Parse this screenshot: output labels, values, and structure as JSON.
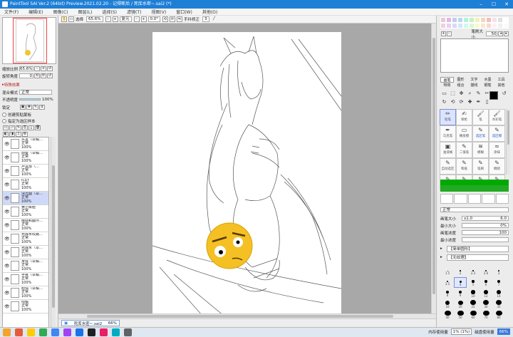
{
  "window": {
    "title": "PaintTool SAI Ver.2 (64bit) Preview.2021.02.20 - 记得断后 / 死库水密~.sai2 (*)"
  },
  "menu": [
    "文件(F)",
    "编辑(E)",
    "图像(C)",
    "图层(L)",
    "选择(S)",
    "滤镜(T)",
    "视图(V)",
    "窗口(W)",
    "其他(O)"
  ],
  "navigator": {
    "zoom_label": "缩放比例",
    "zoom_value": "65.6%",
    "angle_label": "旋转角度",
    "angle_value": "0"
  },
  "layer_props": {
    "section": "特殊效果",
    "blend_label": "混合模式",
    "blend_value": "正常",
    "opacity_label": "不透明度",
    "opacity_value": "100%",
    "lock_label": "锁定",
    "clip_label": "创建剪贴蒙板",
    "ref_label": "指定为选区样本"
  },
  "layers": [
    {
      "name": "头发（草稿…",
      "mode": "正常",
      "opacity": "100%"
    },
    {
      "name": "頭髮（草稿…",
      "mode": "正常",
      "opacity": "100%"
    },
    {
      "name": "卢冥部（…",
      "mode": "正常",
      "opacity": "100%"
    },
    {
      "name": "ICEY",
      "mode": "正常",
      "opacity": "100%"
    },
    {
      "name": "泳光面（草…",
      "mode": "正常",
      "opacity": "100%",
      "selected": true
    },
    {
      "name": "黄小菜脸",
      "mode": "正常",
      "opacity": "100%"
    },
    {
      "name": "缠绕和腿环…",
      "mode": "正常",
      "opacity": "100%"
    },
    {
      "name": "死库水纹路…",
      "mode": "正常",
      "opacity": "100%"
    },
    {
      "name": "死库水（草…",
      "mode": "正常",
      "opacity": "100%"
    },
    {
      "name": "身体（草稿…",
      "mode": "正常",
      "opacity": "100%"
    },
    {
      "name": "手臂（草稿…",
      "mode": "正常",
      "opacity": "100%"
    },
    {
      "name": "脸情（草稿…",
      "mode": "正常",
      "opacity": "100%"
    },
    {
      "name": "线稿",
      "mode": "正常",
      "opacity": "100%"
    }
  ],
  "canvas_toolbar": {
    "select_label": "选择",
    "zoom": "65.6%",
    "fit_label": "复元",
    "angle": "0.0°",
    "stab_label": "手抖修正",
    "stab_value": "3"
  },
  "doc_tab": {
    "name": "死库水密~.sai2",
    "zoom": "66%"
  },
  "right": {
    "size_label": "笔刷大小",
    "size_value": "50",
    "tool_tabs": [
      "画笔",
      "图形",
      "文字",
      "水墨",
      "工具",
      "特效",
      "组合",
      "描线",
      "钢笔",
      "其他"
    ],
    "tool_glyphs": [
      "▭",
      "⬚",
      "✥",
      "⌕",
      "✎",
      "✂",
      "T",
      "↺",
      "↻",
      "⟲",
      "⟳",
      "✚",
      "✒",
      "▯"
    ],
    "brushes": [
      {
        "name": "铅笔",
        "icon": "✏",
        "active": true
      },
      {
        "name": "喷枪",
        "icon": "✍"
      },
      {
        "name": "笔",
        "icon": "🖌"
      },
      {
        "name": "水彩笔",
        "icon": "🖌"
      },
      {
        "name": "马克笔",
        "icon": "✒"
      },
      {
        "name": "橡皮擦",
        "icon": "▭"
      },
      {
        "name": "选区笔",
        "icon": "✎",
        "blue": true
      },
      {
        "name": "选区擦",
        "icon": "✎",
        "blue": true
      },
      {
        "name": "油漆桶",
        "icon": "▣"
      },
      {
        "name": "二值笔",
        "icon": "✎"
      },
      {
        "name": "模糊",
        "icon": "≋"
      },
      {
        "name": "涂抹",
        "icon": "≈"
      },
      {
        "name": "自动选区",
        "icon": "✎"
      },
      {
        "name": "和纸",
        "icon": "✎"
      },
      {
        "name": "笔刷",
        "icon": "✎"
      },
      {
        "name": "缠绕",
        "icon": "✎"
      },
      {
        "name": "钢笔",
        "icon": "✎"
      },
      {
        "name": "二值",
        "icon": "✎"
      },
      {
        "name": "选区",
        "icon": "✎",
        "blue": true
      },
      {
        "name": "二值",
        "icon": "✎"
      }
    ],
    "blend_value": "正常",
    "params": [
      {
        "label": "画笔大小",
        "v1": "x1.0",
        "v2": "6.0"
      },
      {
        "label": "最小大小",
        "v1": "",
        "v2": "0%"
      },
      {
        "label": "画笔浓度",
        "v1": "",
        "v2": "100"
      },
      {
        "label": "最小浓度",
        "v1": "",
        "v2": ""
      }
    ],
    "shape_dropdown": "【简单圆形】",
    "texture_dropdown": "【无纹理】",
    "dots": [
      {
        "label": "1.5",
        "size": 1
      },
      {
        "label": "2",
        "size": 1.5
      },
      {
        "label": "2.3",
        "size": 1.8
      },
      {
        "label": "2.6",
        "size": 2
      },
      {
        "label": "3",
        "size": 2.2
      },
      {
        "label": "3.5",
        "size": 2.5
      },
      {
        "label": "4",
        "size": 3,
        "active": true
      },
      {
        "label": "5",
        "size": 3.3
      },
      {
        "label": "6",
        "size": 3.6
      },
      {
        "label": "7",
        "size": 4
      },
      {
        "label": "8",
        "size": 4.4
      },
      {
        "label": "9",
        "size": 4.8
      },
      {
        "label": "10",
        "size": 5.2
      },
      {
        "label": "12",
        "size": 5.6
      },
      {
        "label": "14",
        "size": 6
      },
      {
        "label": "16",
        "size": 6.5
      },
      {
        "label": "20",
        "size": 7
      },
      {
        "label": "25",
        "size": 7.5
      },
      {
        "label": "30",
        "size": 8
      },
      {
        "label": "35",
        "size": 8.5
      },
      {
        "label": "40",
        "size": 9
      },
      {
        "label": "50",
        "size": 9
      },
      {
        "label": "60",
        "size": 9
      },
      {
        "label": "70",
        "size": 9
      },
      {
        "label": "80",
        "size": 9
      }
    ]
  },
  "status": {
    "mem_label": "内存使用量",
    "mem_value": "1% (1%)",
    "disk_label": "磁盘使用量",
    "disk_value": "66%"
  },
  "colors": {
    "accent": "#1e7fd6",
    "selected_layer": "#cfd9f7"
  }
}
